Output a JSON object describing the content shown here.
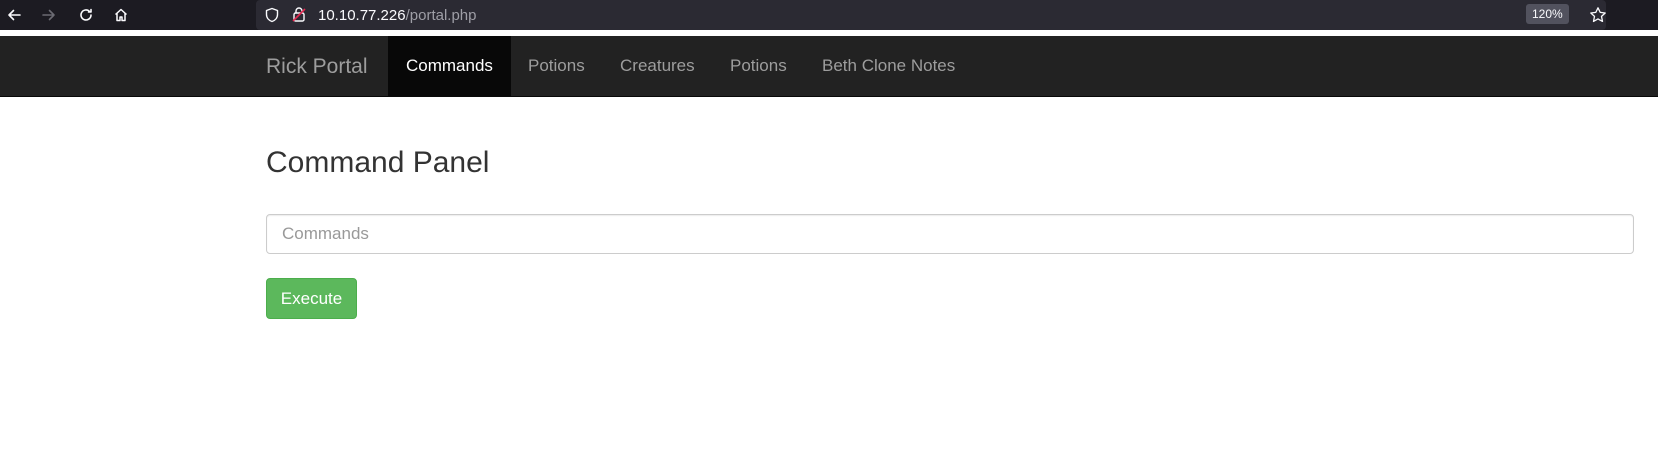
{
  "browser": {
    "url_host": "10.10.77.226",
    "url_path": "/portal.php",
    "zoom": "120%",
    "icons": [
      "back-arrow-icon",
      "forward-arrow-icon",
      "reload-icon",
      "home-icon",
      "shield-icon",
      "lock-icon",
      "star-icon"
    ]
  },
  "navbar": {
    "brand": "Rick Portal",
    "links": [
      {
        "label": "Commands",
        "active": true
      },
      {
        "label": "Potions",
        "active": false
      },
      {
        "label": "Creatures",
        "active": false
      },
      {
        "label": "Potions",
        "active": false
      },
      {
        "label": "Beth Clone Notes",
        "active": false
      }
    ]
  },
  "main": {
    "title": "Command Panel",
    "input_placeholder": "Commands",
    "input_value": "",
    "execute_label": "Execute"
  },
  "colors": {
    "navbar_bg": "#222222",
    "active_link_bg": "#080808",
    "execute_button": "#5cb85c"
  }
}
